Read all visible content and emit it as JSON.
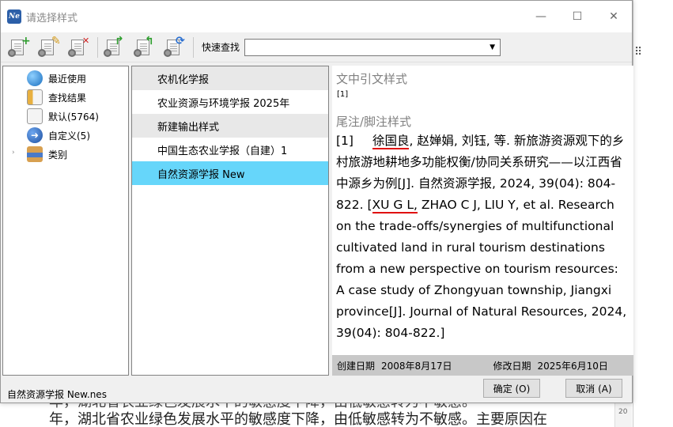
{
  "background": {
    "text_line": "年，湖北省农业绿色发展水平的敏感度下降，由低敏感转为不敏感。主要原因在",
    "text_line_top": "年，湖北省农业绿色发展水平的敏感度下降，由低敏感转为不敏感。",
    "ruler_tick": "20"
  },
  "dialog": {
    "title": "请选择样式",
    "app_icon_text": "Ne",
    "window_controls": {
      "minimize": "—",
      "maximize": "☐",
      "close": "✕"
    }
  },
  "toolbar": {
    "quick_search_label": "快速查找",
    "quick_search_value": "",
    "icons": [
      "new-style-icon",
      "edit-style-icon",
      "delete-style-icon",
      "export-style-icon",
      "import-style-icon",
      "update-style-icon"
    ]
  },
  "tree": {
    "items": [
      {
        "label": "最近使用",
        "icon": "globe-icon"
      },
      {
        "label": "查找结果",
        "icon": "search-folder-icon"
      },
      {
        "label": "默认(5764)",
        "icon": "default-folder-icon"
      },
      {
        "label": "自定义(5)",
        "icon": "custom-arrow-icon"
      },
      {
        "label": "类别",
        "icon": "category-icon"
      }
    ]
  },
  "style_list": {
    "items": [
      {
        "label": "农机化学报"
      },
      {
        "label": "农业资源与环境学报 2025年"
      },
      {
        "label": "新建输出样式"
      },
      {
        "label": "中国生态农业学报（自建）1"
      },
      {
        "label": "自然资源学报 New"
      }
    ],
    "selected_index": 4
  },
  "preview": {
    "citation_title": "文中引文样式",
    "citation_value": "[1]",
    "footnote_title": "尾注/脚注样式",
    "ref_num": "[1]",
    "ref_author1": "徐国良",
    "ref_part1": ", 赵婵娟, 刘钰, 等. 新旅游资源观下的乡村旅游地耕地多功能权衡/协同关系研究——以江西省中源乡为例[J]. 自然资源学报, 2024, 39(04): 804-822. [",
    "ref_author_en": "XU G L,",
    "ref_part2": " ZHAO C J, LIU Y, et al. Research on the trade-offs/synergies of multifunctional cultivated land in rural tourism destinations from a new perspective on tourism resources: A case study of Zhongyuan township, Jiangxi province[J]. Journal of Natural Resources, 2024, 39(04): 804-822.]",
    "created_label": "创建日期",
    "created_value": "2008年8月17日",
    "modified_label": "修改日期",
    "modified_value": "2025年6月10日"
  },
  "statusbar": {
    "file_name": "自然资源学报 New.nes",
    "ok_label": "确定 (O)",
    "cancel_label": "取消 (A)"
  },
  "colors": {
    "selected_row": "#66d6fa",
    "underline": "#e01010",
    "footer_bar": "#c8c8c8"
  }
}
